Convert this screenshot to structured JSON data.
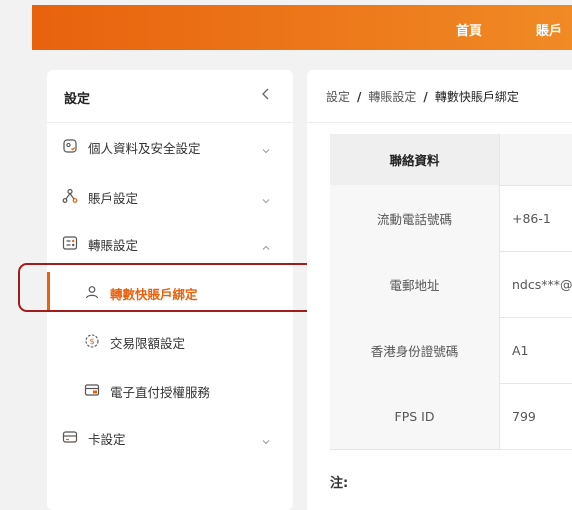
{
  "topnav": {
    "items": [
      "首頁",
      "賬戶"
    ]
  },
  "sidebar": {
    "title": "設定",
    "collapse_icon": "chevron-left-icon",
    "items": [
      {
        "label": "個人資料及安全設定",
        "icon": "profile-shield-icon",
        "expanded": false
      },
      {
        "label": "賬戶設定",
        "icon": "account-tree-icon",
        "expanded": false
      },
      {
        "label": "轉賬設定",
        "icon": "transfer-settings-icon",
        "expanded": true,
        "children": [
          {
            "label": "轉數快賬戶綁定",
            "icon": "user-icon",
            "active": true
          },
          {
            "label": "交易限額設定",
            "icon": "dollar-circle-icon",
            "active": false
          },
          {
            "label": "電子直付授權服務",
            "icon": "edda-card-icon",
            "active": false
          }
        ]
      },
      {
        "label": "卡設定",
        "icon": "card-icon",
        "expanded": false
      }
    ]
  },
  "breadcrumb": {
    "items": [
      "設定",
      "轉賬設定",
      "轉數快賬戶綁定"
    ],
    "separator": "/"
  },
  "table": {
    "header": "聯絡資料",
    "rows": [
      {
        "label": "流動電話號碼",
        "value": "+86-1"
      },
      {
        "label": "電郵地址",
        "value": "ndcs***@"
      },
      {
        "label": "香港身份證號碼",
        "value": "A1"
      },
      {
        "label": "FPS ID",
        "value": "799"
      }
    ]
  },
  "note_label": "注:",
  "colors": {
    "accent": "#e8620e",
    "highlight": "#a01d1d"
  }
}
